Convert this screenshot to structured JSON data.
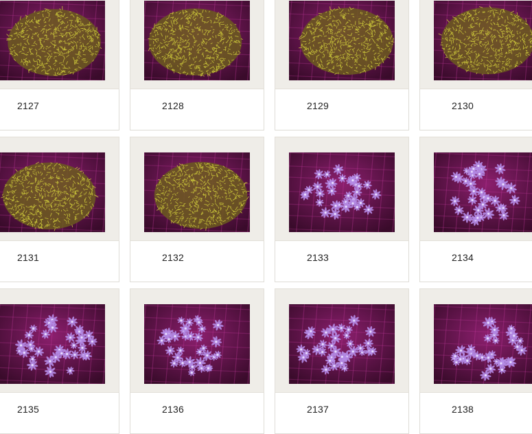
{
  "gallery": {
    "items": [
      {
        "id": "2127",
        "palette": "yellow"
      },
      {
        "id": "2128",
        "palette": "yellow"
      },
      {
        "id": "2129",
        "palette": "yellow"
      },
      {
        "id": "2130",
        "palette": "yellow"
      },
      {
        "id": "2131",
        "palette": "yellow"
      },
      {
        "id": "2132",
        "palette": "yellow"
      },
      {
        "id": "2133",
        "palette": "violet"
      },
      {
        "id": "2134",
        "palette": "violet"
      },
      {
        "id": "2135",
        "palette": "violet"
      },
      {
        "id": "2136",
        "palette": "violet"
      },
      {
        "id": "2137",
        "palette": "violet"
      },
      {
        "id": "2138",
        "palette": "violet"
      }
    ]
  },
  "colors": {
    "frame": "#efede8",
    "tank_bg": "#3a0b2b",
    "tank_glow": "#8c1f6e",
    "yellow_polyp": "#c8c23a",
    "yellow_core": "#6b5a1e",
    "violet_polyp": "#b48be6",
    "violet_core": "#e8dcff"
  }
}
